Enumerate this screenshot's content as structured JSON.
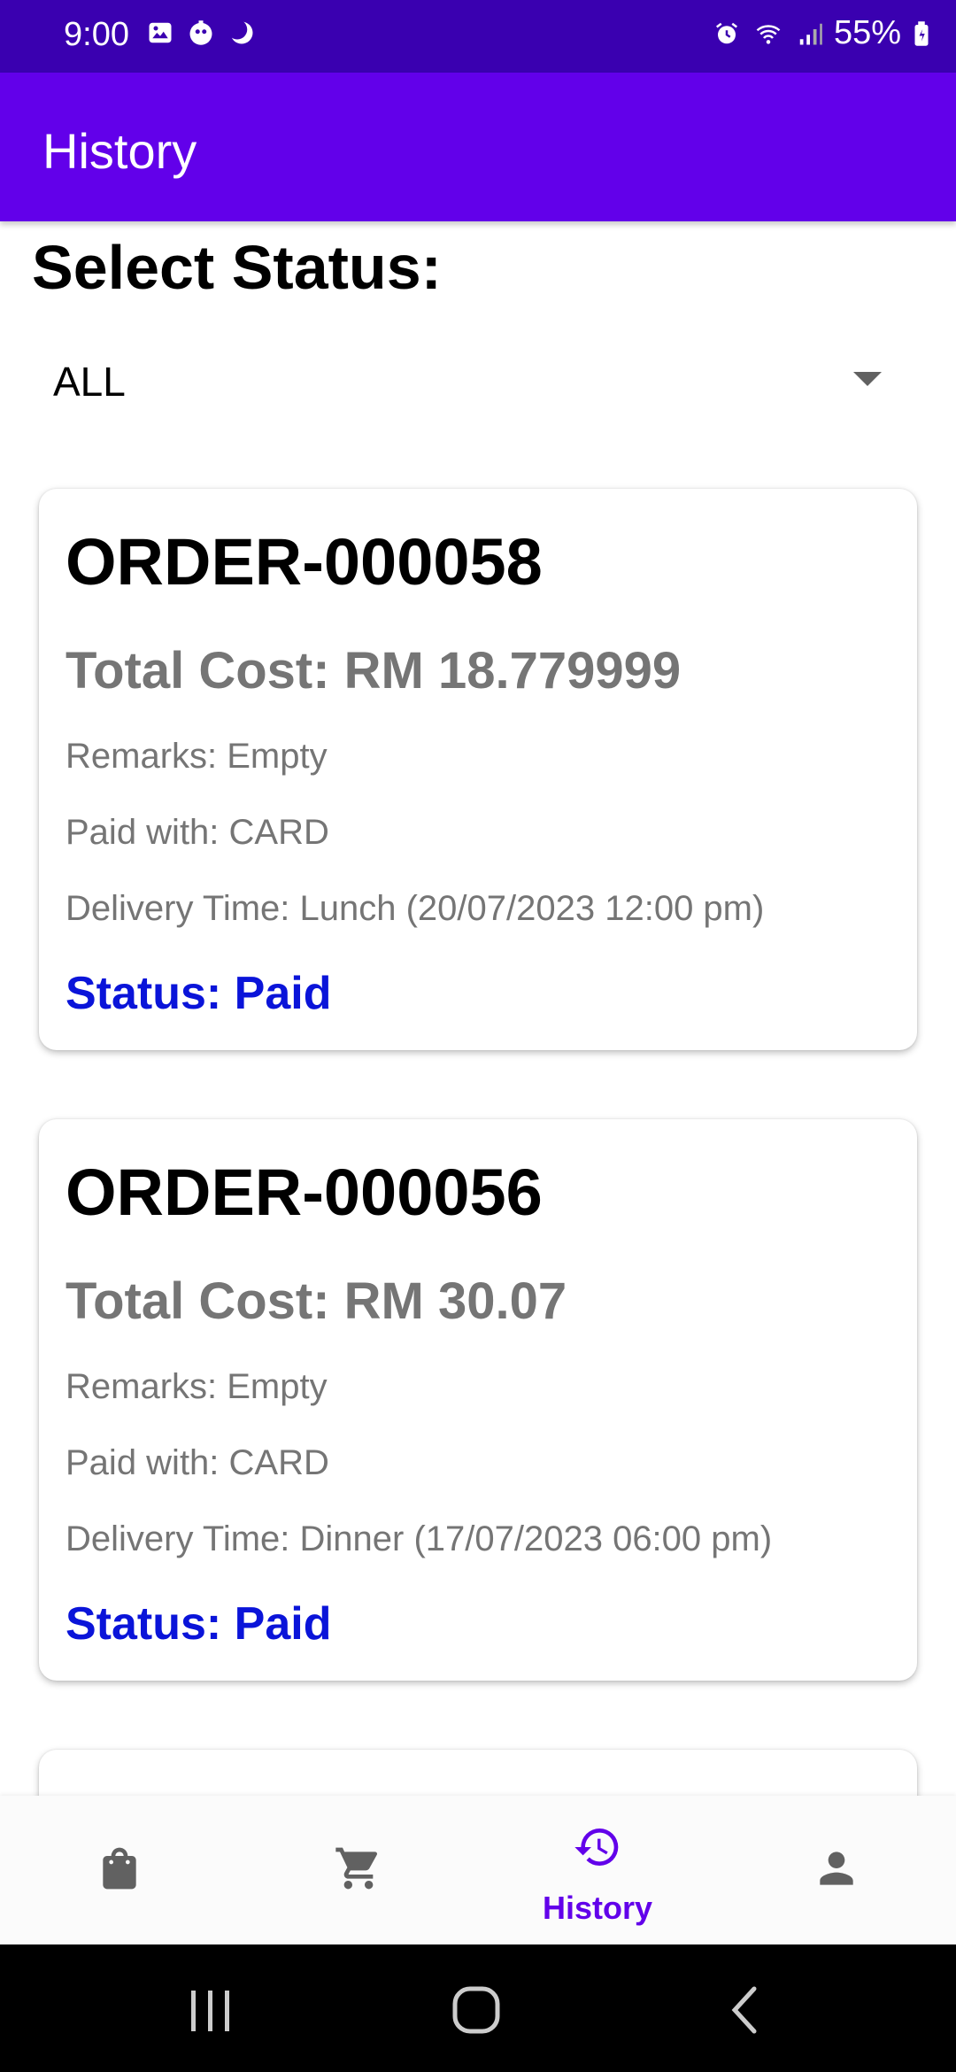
{
  "status_bar": {
    "time": "9:00",
    "left_icons": [
      "gallery-icon",
      "app-icon",
      "moon-icon"
    ],
    "right_icons": [
      "alarm-icon",
      "wifi-icon",
      "signal-icon"
    ],
    "battery": "55%"
  },
  "app_bar": {
    "title": "History"
  },
  "filter": {
    "label": "Select Status:",
    "selected": "ALL"
  },
  "orders": [
    {
      "id": "ORDER-000058",
      "total": "Total Cost: RM 18.779999",
      "remarks": "Remarks: Empty",
      "paid_with": "Paid with: CARD",
      "delivery": "Delivery Time: Lunch (20/07/2023 12:00 pm)",
      "status": "Status: Paid"
    },
    {
      "id": "ORDER-000056",
      "total": "Total Cost: RM 30.07",
      "remarks": "Remarks: Empty",
      "paid_with": "Paid with: CARD",
      "delivery": "Delivery Time: Dinner (17/07/2023 06:00 pm)",
      "status": "Status: Paid"
    }
  ],
  "bottom_nav": {
    "items": [
      {
        "icon": "shopping-bag-icon",
        "label": ""
      },
      {
        "icon": "cart-icon",
        "label": ""
      },
      {
        "icon": "history-icon",
        "label": "History",
        "active": true
      },
      {
        "icon": "person-icon",
        "label": ""
      }
    ]
  },
  "colors": {
    "status_bar": "#3a00b0",
    "app_bar": "#6200ea",
    "status_text": "#0a14d9",
    "secondary_text": "#757575"
  }
}
